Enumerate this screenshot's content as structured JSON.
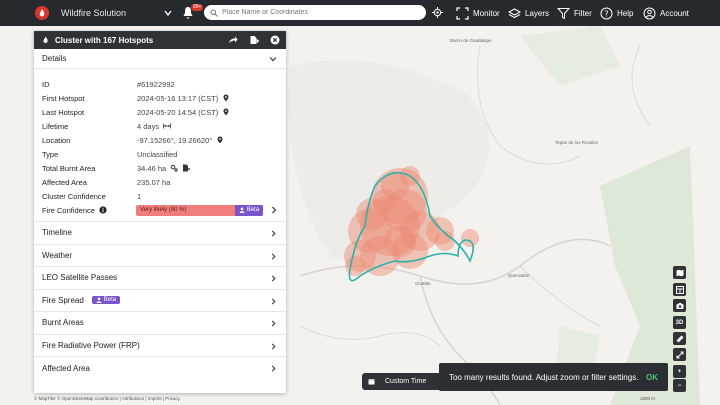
{
  "app": {
    "title": "Wildfire Solution",
    "notification_count": "99+",
    "search_placeholder": "Place Name or Coordinates",
    "nav": {
      "monitor": "Monitor",
      "layers": "Layers",
      "filter": "Filter",
      "help": "Help",
      "account": "Account"
    }
  },
  "panel": {
    "title": "Cluster with 167 Hotspots",
    "details_label": "Details",
    "details": {
      "id": {
        "label": "ID",
        "value": "#61922992"
      },
      "first": {
        "label": "First Hotspot",
        "value": "2024-05-16 13:17 (CST)"
      },
      "last": {
        "label": "Last Hotspot",
        "value": "2024-05-20 14:54 (CST)"
      },
      "lifetime": {
        "label": "Lifetime",
        "value": "4 days"
      },
      "location": {
        "label": "Location",
        "value": "-97.15266°, 19.26620°"
      },
      "type": {
        "label": "Type",
        "value": "Unclassified"
      },
      "burnt": {
        "label": "Total Burnt Area",
        "value": "34.46 ha"
      },
      "affected": {
        "label": "Affected Area",
        "value": "235.07 ha"
      },
      "cluster_conf": {
        "label": "Cluster Confidence",
        "value": "1"
      },
      "fire_conf": {
        "label": "Fire Confidence",
        "value": "Very likely (90 %)",
        "beta": "Beta"
      }
    },
    "sections": [
      {
        "label": "Timeline"
      },
      {
        "label": "Weather"
      },
      {
        "label": "LEO Satellite Passes"
      },
      {
        "label": "Fire Spread",
        "beta": "Beta"
      },
      {
        "label": "Burnt Areas"
      },
      {
        "label": "Fire Radiative Power (FRP)"
      },
      {
        "label": "Affected Area"
      }
    ]
  },
  "map": {
    "places": {
      "p1": "Tepan de los Rosales",
      "p2": "Quimixtlán",
      "p3": "Barrio de Guadalupe",
      "p4": "Ocotlán"
    }
  },
  "right_tools": {
    "three_d": "3D",
    "zoom_in": "+",
    "zoom_out": "−"
  },
  "bottom": {
    "custom_time": "Custom Time",
    "toast": "Too many results found. Adjust zoom or filter settings.",
    "ok": "OK",
    "attribution": "© MapTiler © OpenStreetMap contributors | Attributions | Imprint | Privacy",
    "scale": "1500 m"
  },
  "colors": {
    "accent": "#d9352b",
    "beta": "#7a55c9",
    "confidence": "#f07e7c",
    "cluster_outline": "#2bb3a9"
  }
}
